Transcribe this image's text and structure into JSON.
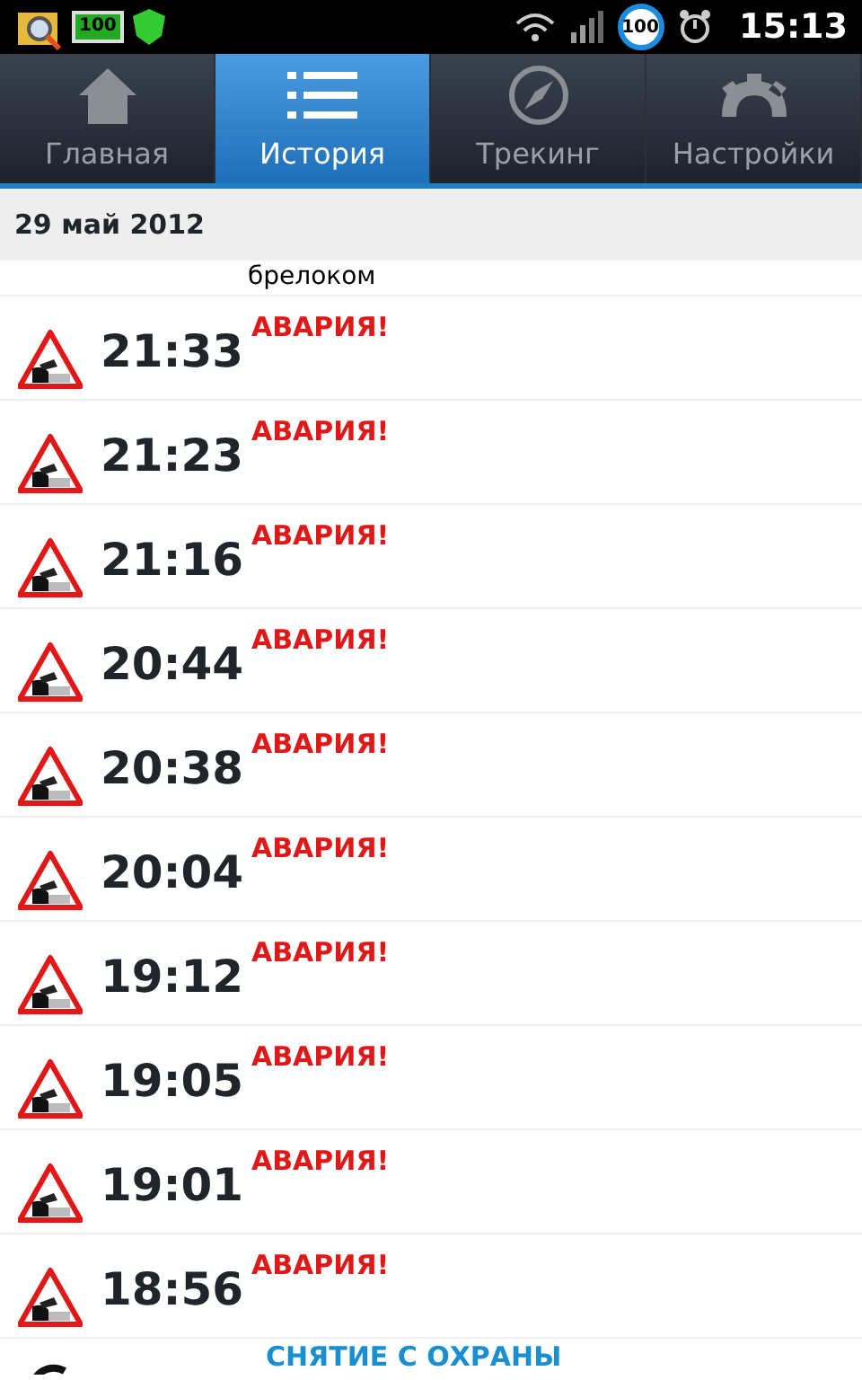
{
  "status_bar": {
    "battery_widget": "100",
    "battery_badge": "100",
    "time": "15:13"
  },
  "tabs": [
    {
      "label": "Главная",
      "kind": "home",
      "selected": false
    },
    {
      "label": "История",
      "kind": "list",
      "selected": true
    },
    {
      "label": "Трекинг",
      "kind": "compass",
      "selected": false
    },
    {
      "label": "Настройки",
      "kind": "gear",
      "selected": false
    }
  ],
  "date_header": "29 май 2012",
  "events": [
    {
      "kind": "partial_top",
      "event": "брелоком"
    },
    {
      "kind": "crash",
      "time": "21:33",
      "event": "АВАРИЯ!"
    },
    {
      "kind": "crash",
      "time": "21:23",
      "event": "АВАРИЯ!"
    },
    {
      "kind": "crash",
      "time": "21:16",
      "event": "АВАРИЯ!"
    },
    {
      "kind": "crash",
      "time": "20:44",
      "event": "АВАРИЯ!"
    },
    {
      "kind": "crash",
      "time": "20:38",
      "event": "АВАРИЯ!"
    },
    {
      "kind": "crash",
      "time": "20:04",
      "event": "АВАРИЯ!"
    },
    {
      "kind": "crash",
      "time": "19:12",
      "event": "АВАРИЯ!"
    },
    {
      "kind": "crash",
      "time": "19:05",
      "event": "АВАРИЯ!"
    },
    {
      "kind": "crash",
      "time": "19:01",
      "event": "АВАРИЯ!"
    },
    {
      "kind": "crash",
      "time": "18:56",
      "event": "АВАРИЯ!"
    },
    {
      "kind": "disarm",
      "event": "СНЯТИЕ С ОХРАНЫ"
    }
  ]
}
